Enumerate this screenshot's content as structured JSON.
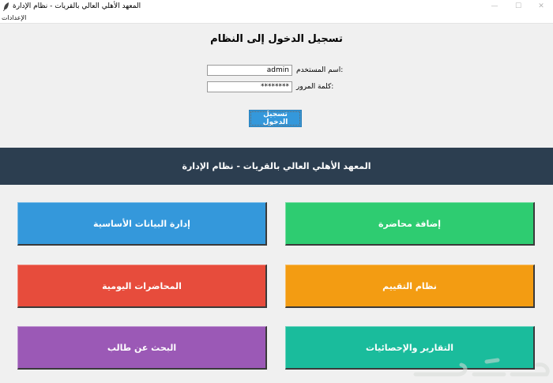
{
  "window": {
    "title": "المعهد الأهلي العالي بالقريات - نظام الإدارة",
    "minimize_glyph": "—",
    "maximize_glyph": "☐",
    "close_glyph": "✕"
  },
  "menu": {
    "settings": "الإعدادات"
  },
  "login": {
    "title": "تسجيل الدخول إلى النظام",
    "username_label": ":اسم المستخدم",
    "username_value": "admin",
    "password_label": ":كلمة المرور",
    "password_value": "********",
    "submit_label": "تسجيل الدخول"
  },
  "header": {
    "text": "المعهد الأهلي العالي بالقريات - نظام الإدارة"
  },
  "tiles": {
    "basic_data": "إدارة البيانات الأساسية",
    "add_lecture": "إضافة محاضرة",
    "daily_lectures": "المحاضرات اليومية",
    "evaluation": "نظام التقييم",
    "search_student": "البحث عن طالب",
    "reports": "التقارير والإحصائيات"
  },
  "colors": {
    "blue": "#3498db",
    "green": "#2ecc71",
    "red": "#e74c3c",
    "orange": "#f39c12",
    "purple": "#9b59b6",
    "teal": "#1abc9c",
    "header": "#2c3e50"
  },
  "icons": {
    "app": "feather-icon",
    "watermark": "watermark-logo"
  }
}
